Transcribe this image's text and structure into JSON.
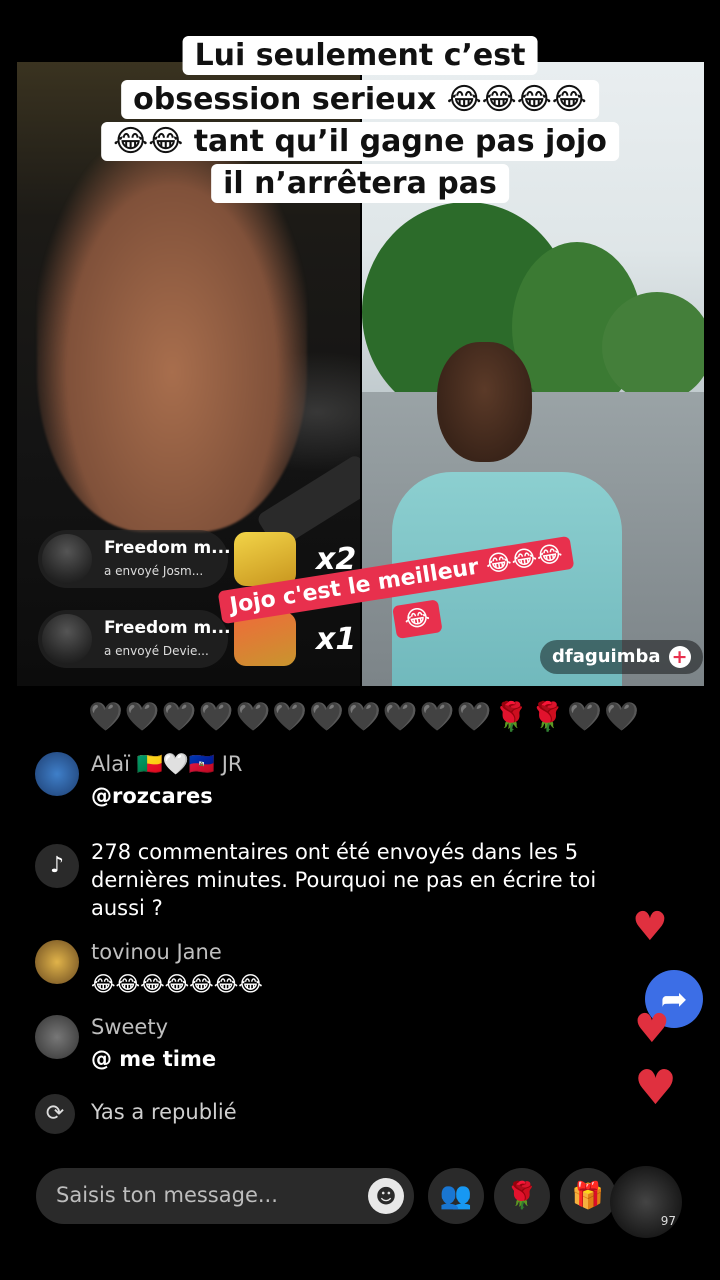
{
  "caption": {
    "lines": [
      "Lui seulement c’est",
      "obsession serieux 😂😂😂😂",
      "😂😂 tant qu’il gagne pas jojo",
      "il n’arrêtera pas"
    ]
  },
  "sticker": {
    "line1": "Jojo c'est le meilleur 😂😂😂",
    "line2": "😂"
  },
  "gifts": [
    {
      "name": "Freedom m...",
      "sub": "a envoyé  Josm...",
      "multiplier": "x2"
    },
    {
      "name": "Freedom m...",
      "sub": "a envoyé  Devie...",
      "multiplier": "x1"
    }
  ],
  "guest": {
    "handle": "dfaguimba",
    "follow": "+"
  },
  "chat": {
    "hearts": "🖤🖤🖤🖤🖤🖤🖤🖤🖤🖤🖤🌹🌹🖤🖤",
    "messages": [
      {
        "user": "Alaï 🇧🇯🤍🇭🇹 JR",
        "text": "@rozcares"
      },
      {
        "user": "tovinou Jane",
        "text": "😂😂😂😂😂😂😂"
      },
      {
        "user": "Sweety",
        "text": "@ me time"
      }
    ],
    "system": "278 commentaires ont été envoyés dans les 5 dernières minutes. Pourquoi ne pas en écrire toi aussi ?",
    "repost": "Yas a republié"
  },
  "bottom": {
    "placeholder": "Saisis ton message...",
    "share_count": "97"
  },
  "icons": {
    "tiktok": "♪",
    "emoji": "☻",
    "people": "👥",
    "rose": "🌹",
    "gift": "🎁",
    "share": "➦",
    "repost": "⟳",
    "heart": "♥"
  },
  "colors": {
    "accent_red": "#e8304d",
    "share_blue": "#3c6ee6"
  }
}
